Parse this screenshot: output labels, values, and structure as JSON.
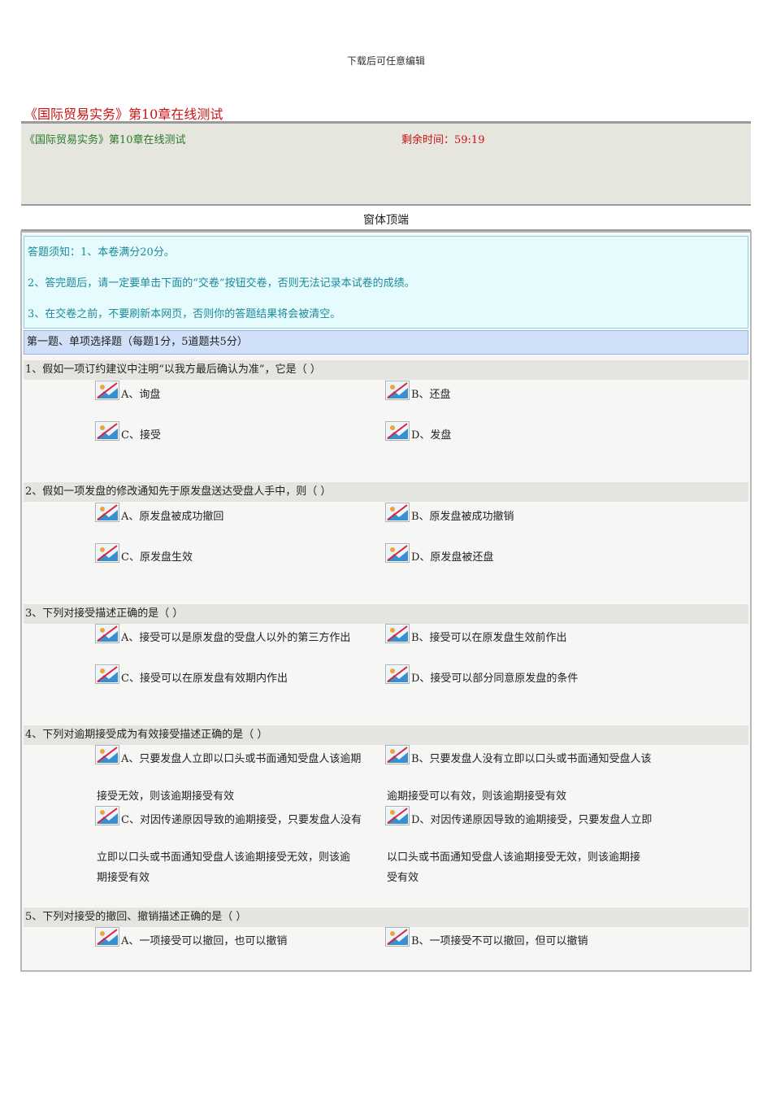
{
  "doc_note": "下载后可任意编辑",
  "page_title": "《国际贸易实务》第10章在线测试",
  "header": {
    "subtitle": "《国际贸易实务》第10章在线测试",
    "timer": "剩余时间：59:19"
  },
  "form_top": "窗体顶端",
  "notice": {
    "lines": [
      "答题须知：1、本卷满分20分。",
      "2、答完题后，请一定要单击下面的“交卷”按钮交卷，否则无法记录本试卷的成绩。",
      "3、在交卷之前，不要刷新本网页，否则你的答题结果将会被清空。"
    ]
  },
  "section_title": "第一题、单项选择题（每题1分，5道题共5分）",
  "questions": [
    {
      "title": "1、假如一项订约建议中注明“以我方最后确认为准”，它是（ ）",
      "options": [
        {
          "line1": "A、询盘"
        },
        {
          "line1": "B、还盘"
        },
        {
          "line1": "C、接受"
        },
        {
          "line1": "D、发盘"
        }
      ]
    },
    {
      "title": "2、假如一项发盘的修改通知先于原发盘送达受盘人手中，则（ ）",
      "options": [
        {
          "line1": "A、原发盘被成功撤回"
        },
        {
          "line1": "B、原发盘被成功撤销"
        },
        {
          "line1": "C、原发盘生效"
        },
        {
          "line1": "D、原发盘被还盘"
        }
      ]
    },
    {
      "title": "3、下列对接受描述正确的是（ ）",
      "options": [
        {
          "line1": "A、接受可以是原发盘的受盘人以外的第三方作出"
        },
        {
          "line1": "B、接受可以在原发盘生效前作出"
        },
        {
          "line1": "C、接受可以在原发盘有效期内作出"
        },
        {
          "line1": "D、接受可以部分同意原发盘的条件"
        }
      ]
    },
    {
      "title": "4、下列对逾期接受成为有效接受描述正确的是（ ）",
      "options": [
        {
          "line1": "A、只要发盘人立即以口头或书面通知受盘人该逾期",
          "line2": "接受无效，则该逾期接受有效"
        },
        {
          "line1": "B、只要发盘人没有立即以口头或书面通知受盘人该",
          "line2": "逾期接受可以有效，则该逾期接受有效"
        },
        {
          "line1": "C、对因传递原因导致的逾期接受，只要发盘人没有",
          "line2": "立即以口头或书面通知受盘人该逾期接受无效，则该逾",
          "line3": "期接受有效"
        },
        {
          "line1": "D、对因传递原因导致的逾期接受，只要发盘人立即",
          "line2": "以口头或书面通知受盘人该逾期接受无效，则该逾期接",
          "line3": "受有效"
        }
      ]
    },
    {
      "title": "5、下列对接受的撤回、撤销描述正确的是（ ）",
      "options": [
        {
          "line1": "A、一项接受可以撤回，也可以撤销"
        },
        {
          "line1": "B、一项接受不可以撤回，但可以撤销"
        }
      ]
    }
  ]
}
